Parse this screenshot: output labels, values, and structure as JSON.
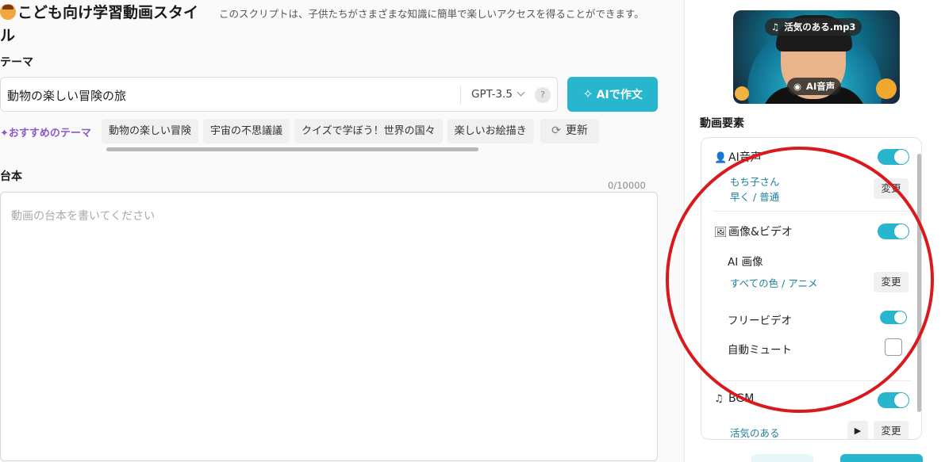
{
  "header": {
    "title": "こども向け学習動画スタイル",
    "description": "このスクリプトは、子供たちがさまざまな知識に簡単で楽しいアクセスを得ることができます。"
  },
  "theme": {
    "label": "テーマ",
    "input_value": "動物の楽しい冒険の旅",
    "model": "GPT-3.5",
    "help": "?",
    "ai_button": "AIで作文"
  },
  "recommended": {
    "label": "おすすめのテーマ",
    "chips": [
      "動物の楽しい冒険",
      "宇宙の不思議議",
      "クイズで学ぼう！世界の国々",
      "楽しいお絵描き"
    ],
    "refresh": "更新"
  },
  "script": {
    "label": "台本",
    "counter": "0/10000",
    "placeholder": "動画の台本を書いてください"
  },
  "sidebar": {
    "thumbnail": {
      "music_pill": "活気のある.mp3",
      "voice_pill": "AI音声"
    },
    "section_title": "動画要素",
    "ai_voice": {
      "label": "AI音声",
      "enabled": true,
      "voice_name": "もち子さん",
      "voice_speed": "早く / 普通",
      "change": "変更"
    },
    "image_video": {
      "label": "画像&ビデオ",
      "enabled": true,
      "ai_image_label": "AI 画像",
      "ai_image_value": "すべての色 / アニメ",
      "change": "変更",
      "free_video_label": "フリービデオ",
      "free_video_enabled": true,
      "auto_mute_label": "自動ミュート",
      "auto_mute_checked": false
    },
    "bgm": {
      "label": "BGM",
      "enabled": true,
      "value": "活気のある",
      "change": "変更"
    }
  },
  "colors": {
    "accent": "#28b6cf",
    "link": "#1e7f9a",
    "recommend": "#8c57c7",
    "annotation": "#d9191d"
  }
}
